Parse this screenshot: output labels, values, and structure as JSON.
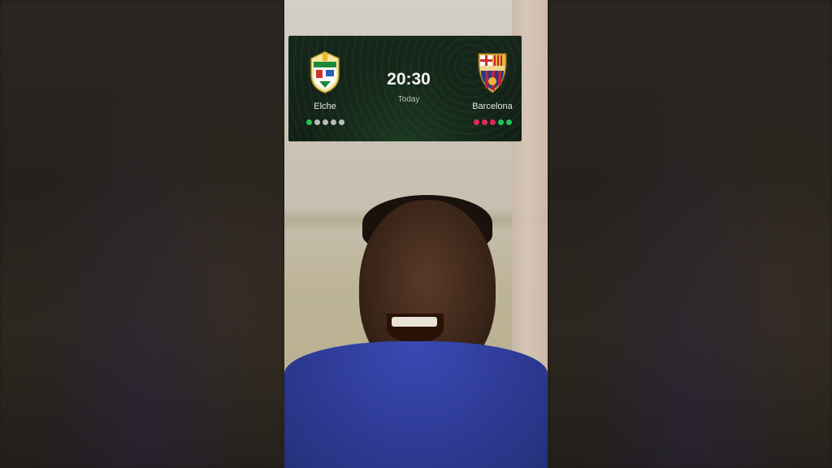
{
  "match": {
    "home": {
      "name": "Elche",
      "crest_icon": "elche-crest-icon",
      "form": [
        "#25c45a",
        "#b9bdb9",
        "#b9bdb9",
        "#b9bdb9",
        "#b9bdb9"
      ]
    },
    "away": {
      "name": "Barcelona",
      "crest_icon": "barcelona-crest-icon",
      "form": [
        "#e02a5a",
        "#e02a5a",
        "#e02a5a",
        "#25c45a",
        "#25c45a"
      ]
    },
    "kickoff_time": "20:30",
    "kickoff_day": "Today"
  },
  "colors": {
    "card_bg": "#152419",
    "win": "#25c45a",
    "draw": "#b9bdb9",
    "loss": "#e02a5a"
  }
}
